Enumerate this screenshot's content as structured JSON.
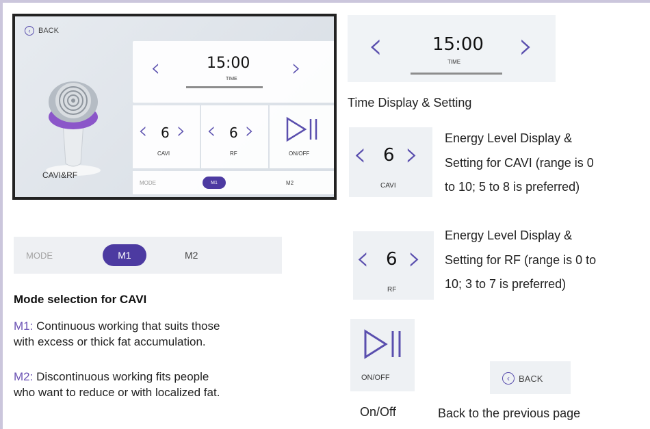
{
  "screen": {
    "back_label": "BACK",
    "device_label": "CAVI&RF",
    "time": {
      "value": "15:00",
      "label": "TIME"
    },
    "cavi": {
      "value": "6",
      "label": "CAVI"
    },
    "rf": {
      "value": "6",
      "label": "RF"
    },
    "onoff": {
      "label": "ON/OFF"
    },
    "mode": {
      "label": "MODE",
      "options": [
        "M1",
        "M2"
      ],
      "selected": "M1"
    }
  },
  "details": {
    "time": {
      "value": "15:00",
      "label": "TIME",
      "caption": "Time Display & Setting"
    },
    "cavi": {
      "value": "6",
      "label": "CAVI",
      "caption_lines": [
        "Energy Level Display &",
        "Setting for CAVI (range is 0",
        "to 10; 5 to 8 is preferred)"
      ]
    },
    "rf": {
      "value": "6",
      "label": "RF",
      "caption_lines": [
        "Energy Level Display &",
        "Setting for RF (range is 0 to",
        "10; 3 to 7 is preferred)"
      ]
    },
    "onoff": {
      "label": "ON/OFF",
      "caption": "On/Off"
    },
    "back": {
      "label": "BACK",
      "caption": "Back to the previous page"
    }
  },
  "mode_section": {
    "strip_label": "MODE",
    "options": [
      "M1",
      "M2"
    ],
    "selected": "M1",
    "title": "Mode selection for CAVI",
    "items": [
      {
        "key": "M1:",
        "text_lines": [
          " Continuous working that suits those",
          "with excess or thick fat accumulation."
        ]
      },
      {
        "key": "M2:",
        "text_lines": [
          " Discontinuous working fits people",
          "who want to reduce or with localized fat."
        ]
      }
    ]
  },
  "colors": {
    "accent": "#4c3aa1",
    "chevron": "#5a4fae",
    "key_text": "#6a51b3",
    "frame": "#cbc6dc"
  },
  "icons": [
    "back-arrow-icon",
    "chevron-left-icon",
    "chevron-right-icon",
    "play-pause-icon"
  ]
}
